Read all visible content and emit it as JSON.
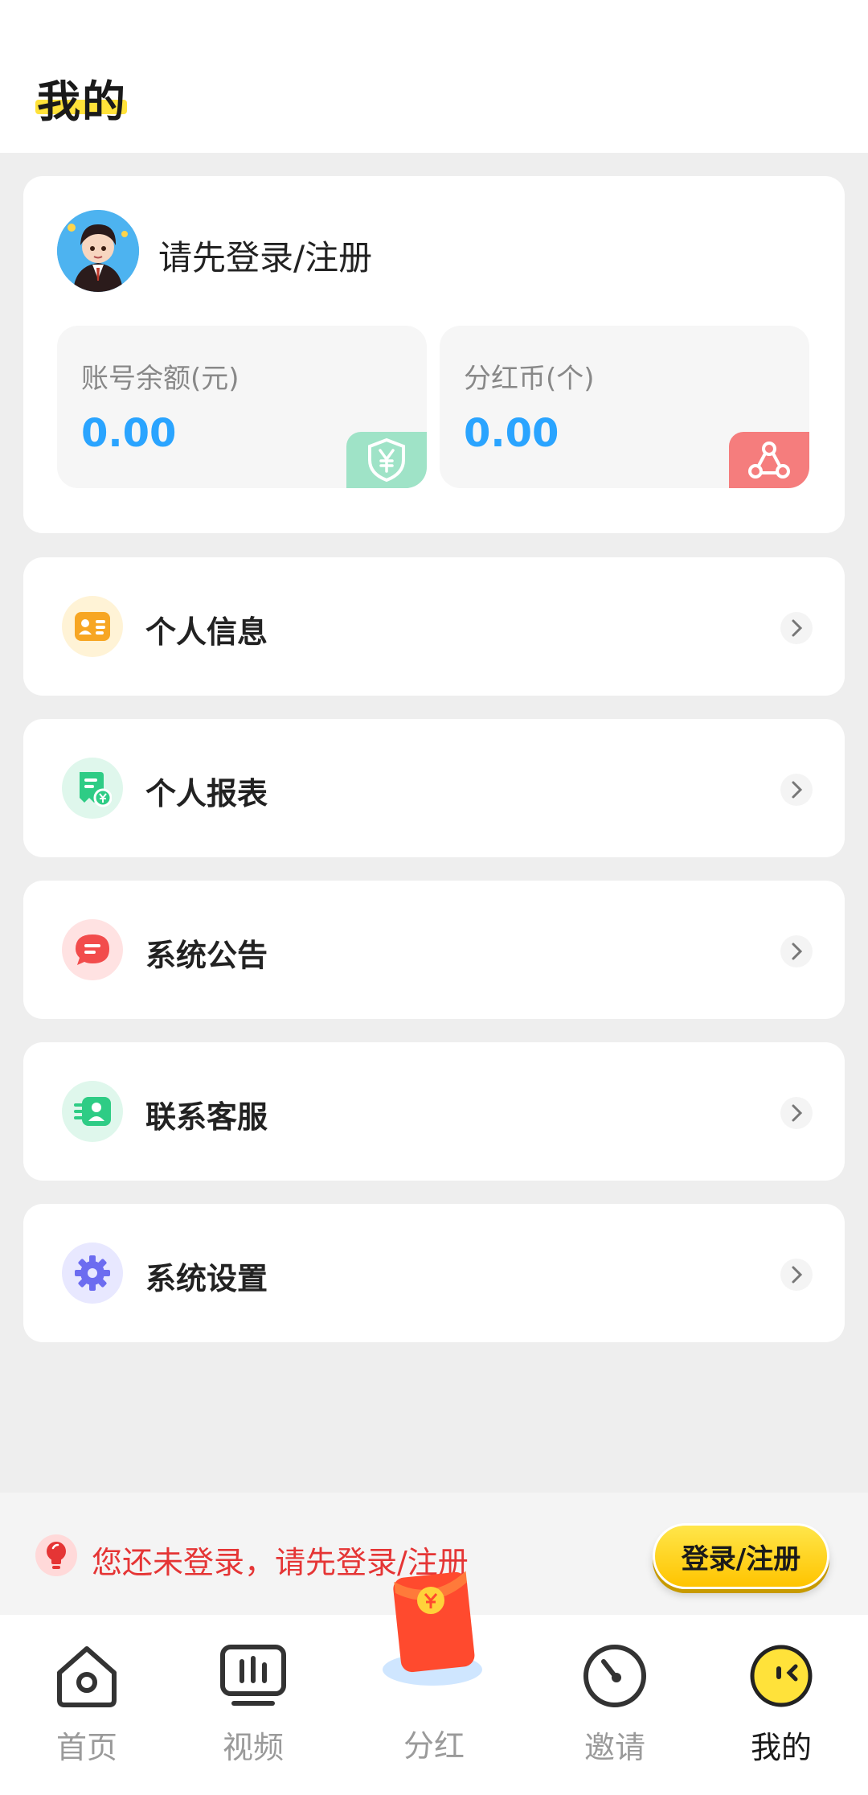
{
  "header": {
    "title": "我的"
  },
  "profile": {
    "login_prompt": "请先登录/注册",
    "balance": {
      "label": "账号余额(元)",
      "value": "0.00"
    },
    "coins": {
      "label": "分红币(个)",
      "value": "0.00"
    }
  },
  "menu": [
    {
      "label": "个人信息",
      "icon": "id-card-icon",
      "color": "#f7a623"
    },
    {
      "label": "个人报表",
      "icon": "report-icon",
      "color": "#2ecc85"
    },
    {
      "label": "系统公告",
      "icon": "message-icon",
      "color": "#f24c4c"
    },
    {
      "label": "联系客服",
      "icon": "contacts-icon",
      "color": "#2ecc85"
    },
    {
      "label": "系统设置",
      "icon": "gear-icon",
      "color": "#6c6cf0"
    }
  ],
  "banner": {
    "text": "您还未登录，请先登录/注册",
    "button": "登录/注册"
  },
  "tabs": [
    {
      "label": "首页",
      "icon": "home-icon"
    },
    {
      "label": "视频",
      "icon": "video-icon"
    },
    {
      "label": "分红",
      "icon": "red-packet-icon"
    },
    {
      "label": "邀请",
      "icon": "invite-icon"
    },
    {
      "label": "我的",
      "icon": "me-icon",
      "active": true
    }
  ],
  "colors": {
    "accent": "#ffd21f",
    "value_blue": "#2aa4ff",
    "warning_red": "#e53535"
  }
}
